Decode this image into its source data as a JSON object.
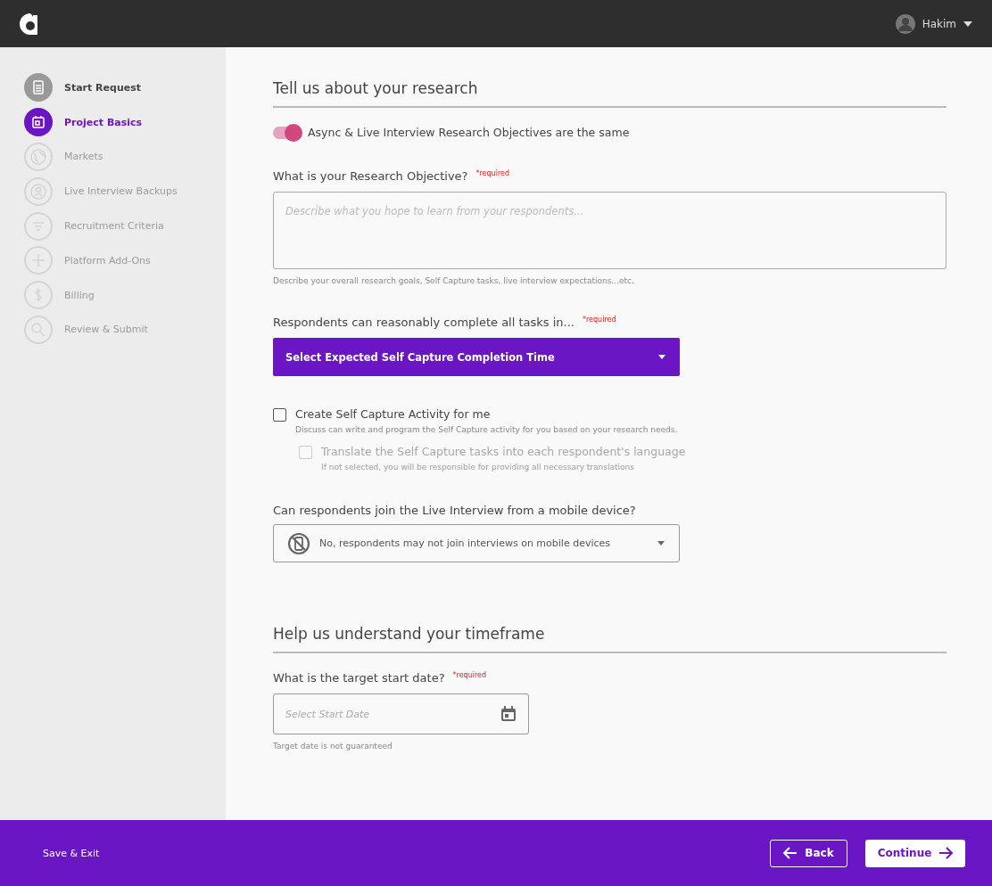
{
  "header": {
    "user": {
      "name": "Hakim"
    }
  },
  "steps": [
    {
      "label": "Start Request",
      "kind": "done"
    },
    {
      "label": "Project Basics",
      "kind": "current"
    },
    {
      "label": "Markets",
      "kind": "upcoming"
    },
    {
      "label": "Live Interview Backups",
      "kind": "upcoming"
    },
    {
      "label": "Recruitment Criteria",
      "kind": "upcoming"
    },
    {
      "label": "Platform Add-Ons",
      "kind": "upcoming"
    },
    {
      "label": "Billing",
      "kind": "upcoming"
    },
    {
      "label": "Review & Submit",
      "kind": "upcoming"
    }
  ],
  "research": {
    "heading": "Tell us about your research",
    "toggle": {
      "label": "Async & Live Interview Research Objectives are the same",
      "on": true
    },
    "objective": {
      "label": "What is your Research Objective?",
      "required": "*required",
      "placeholder": "Describe what you hope to learn from your respondents...",
      "help": "Describe your overall research goals, Self Capture tasks, live interview expectations...etc."
    },
    "completion": {
      "label": "Respondents can reasonably complete all tasks in...",
      "required": "*required",
      "button": "Select Expected Self Capture Completion Time"
    },
    "checkboxes": [
      {
        "label": "Create Self Capture Activity for me",
        "help": "Discuss can write and program the Self Capture activity for you based on your research needs.",
        "checked": false,
        "disabled": false
      },
      {
        "label": "Translate the Self Capture tasks into each respondent's language",
        "help": "If not selected, you will be responsible for providing all necessary translations",
        "checked": false,
        "disabled": true
      }
    ],
    "mobile": {
      "label": "Can respondents join the Live Interview from a mobile device?",
      "value": "No, respondents may not join interviews on mobile devices"
    }
  },
  "timeframe": {
    "heading": "Help us understand your timeframe",
    "start_date": {
      "label": "What is the target start date?",
      "required": "*required",
      "placeholder": "Select Start Date",
      "help": "Target date is not guaranteed"
    }
  },
  "footer": {
    "save_exit": "Save & Exit",
    "back": "Back",
    "continue": "Continue"
  }
}
